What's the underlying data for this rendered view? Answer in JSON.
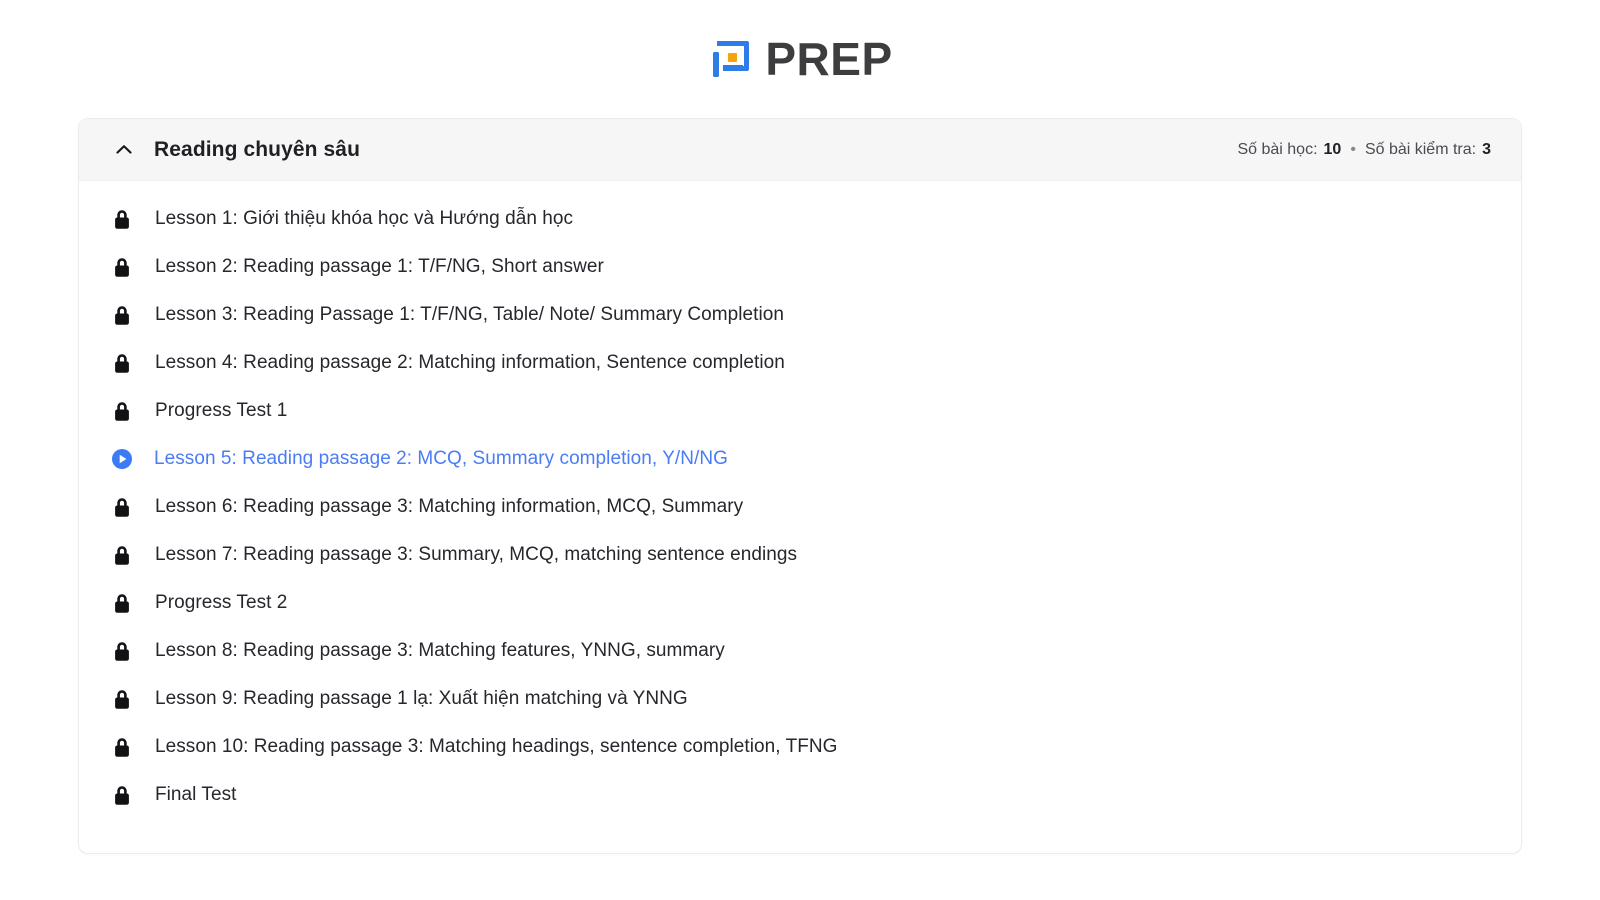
{
  "brand": {
    "name": "PREP",
    "mark_icon": "prep-logo-icon",
    "mark_color_blue": "#2e7ce8",
    "mark_color_orange": "#f7a30e",
    "word_color": "#3d3d3f"
  },
  "card": {
    "header": {
      "collapse_icon": "chevron-up-icon",
      "title": "Reading chuyên sâu",
      "lessons_label": "Số bài học:",
      "lessons_count": "10",
      "separator": "•",
      "tests_label": "Số bài kiểm tra:",
      "tests_count": "3"
    },
    "active_color": "#4a7cf6",
    "lessons": [
      {
        "icon": "lock-icon",
        "label": "Lesson 1: Giới thiệu khóa học và Hướng dẫn học",
        "locked": true,
        "active": false
      },
      {
        "icon": "lock-icon",
        "label": "Lesson 2: Reading passage 1: T/F/NG, Short answer",
        "locked": true,
        "active": false
      },
      {
        "icon": "lock-icon",
        "label": "Lesson 3: Reading Passage 1: T/F/NG, Table/ Note/ Summary Completion",
        "locked": true,
        "active": false
      },
      {
        "icon": "lock-icon",
        "label": "Lesson 4: Reading passage 2: Matching information, Sentence completion",
        "locked": true,
        "active": false
      },
      {
        "icon": "lock-icon",
        "label": "Progress Test 1",
        "locked": true,
        "active": false
      },
      {
        "icon": "play-circle-icon",
        "label": "Lesson 5: Reading passage 2: MCQ, Summary completion, Y/N/NG",
        "locked": false,
        "active": true
      },
      {
        "icon": "lock-icon",
        "label": "Lesson 6: Reading passage 3: Matching information, MCQ, Summary",
        "locked": true,
        "active": false
      },
      {
        "icon": "lock-icon",
        "label": "Lesson 7: Reading passage 3: Summary, MCQ, matching sentence endings",
        "locked": true,
        "active": false
      },
      {
        "icon": "lock-icon",
        "label": "Progress Test 2",
        "locked": true,
        "active": false
      },
      {
        "icon": "lock-icon",
        "label": "Lesson 8: Reading passage 3: Matching features, YNNG, summary",
        "locked": true,
        "active": false
      },
      {
        "icon": "lock-icon",
        "label": "Lesson 9: Reading passage 1 lạ: Xuất hiện matching và YNNG",
        "locked": true,
        "active": false
      },
      {
        "icon": "lock-icon",
        "label": "Lesson 10: Reading passage 3: Matching headings, sentence completion, TFNG",
        "locked": true,
        "active": false
      },
      {
        "icon": "lock-icon",
        "label": "Final Test",
        "locked": true,
        "active": false
      }
    ]
  }
}
